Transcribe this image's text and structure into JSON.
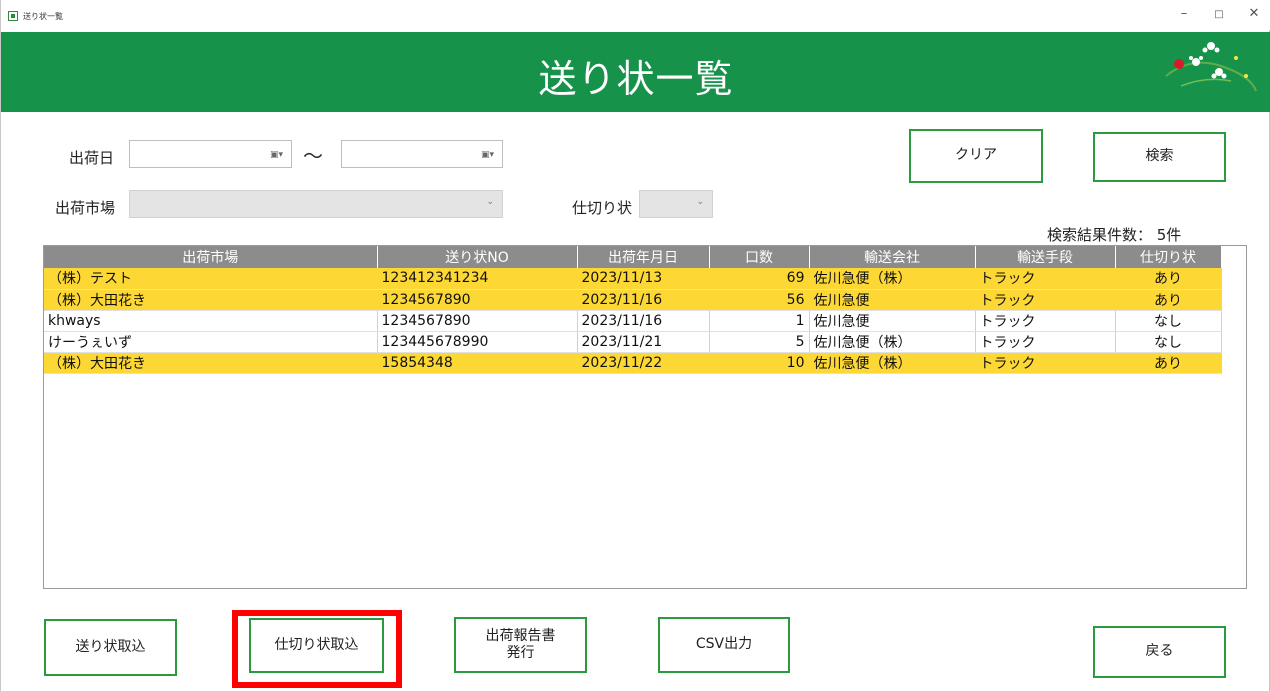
{
  "window": {
    "title": "送り状一覧",
    "minimize": "–",
    "maximize": "□",
    "close": "✕"
  },
  "header": {
    "title": "送り状一覧"
  },
  "filters": {
    "ship_date_label": "出荷日",
    "range_sep": "～",
    "date_from": "",
    "date_to": "",
    "market_label": "出荷市場",
    "market_value": "",
    "statement_label": "仕切り状",
    "statement_value": "",
    "clear_label": "クリア",
    "search_label": "検索"
  },
  "results": {
    "count_text": "検索結果件数： 5件"
  },
  "table": {
    "columns": [
      "出荷市場",
      "送り状NO",
      "出荷年月日",
      "口数",
      "輸送会社",
      "輸送手段",
      "仕切り状"
    ],
    "rows": [
      {
        "market": "（株）テスト",
        "no": "123412341234",
        "date": "2023/11/13",
        "qty": "69",
        "carrier": "佐川急便（株）",
        "method": "トラック",
        "statement": "あり",
        "highlight": true
      },
      {
        "market": "（株）大田花き",
        "no": "1234567890",
        "date": "2023/11/16",
        "qty": "56",
        "carrier": "佐川急便",
        "method": "トラック",
        "statement": "あり",
        "highlight": true
      },
      {
        "market": "khways",
        "no": "1234567890",
        "date": "2023/11/16",
        "qty": "1",
        "carrier": "佐川急便",
        "method": "トラック",
        "statement": "なし",
        "highlight": false
      },
      {
        "market": "けーうぇいず",
        "no": "123445678990",
        "date": "2023/11/21",
        "qty": "5",
        "carrier": "佐川急便（株）",
        "method": "トラック",
        "statement": "なし",
        "highlight": false
      },
      {
        "market": "（株）大田花き",
        "no": "15854348",
        "date": "2023/11/22",
        "qty": "10",
        "carrier": "佐川急便（株）",
        "method": "トラック",
        "statement": "あり",
        "highlight": true
      }
    ]
  },
  "footer": {
    "import_invoice": "送り状取込",
    "import_statement": "仕切り状取込",
    "shipping_report": "出荷報告書\n発行",
    "csv_output": "CSV出力",
    "back": "戻る"
  },
  "colors": {
    "header_green": "#17924a",
    "button_border": "#2a9a3f",
    "row_highlight": "#fdd835",
    "focus_red": "#ff0000"
  },
  "icons": {
    "app": "app-icon",
    "logo": "flower-logo-icon",
    "calendar": "calendar-icon",
    "dropdown": "chevron-down-icon"
  }
}
